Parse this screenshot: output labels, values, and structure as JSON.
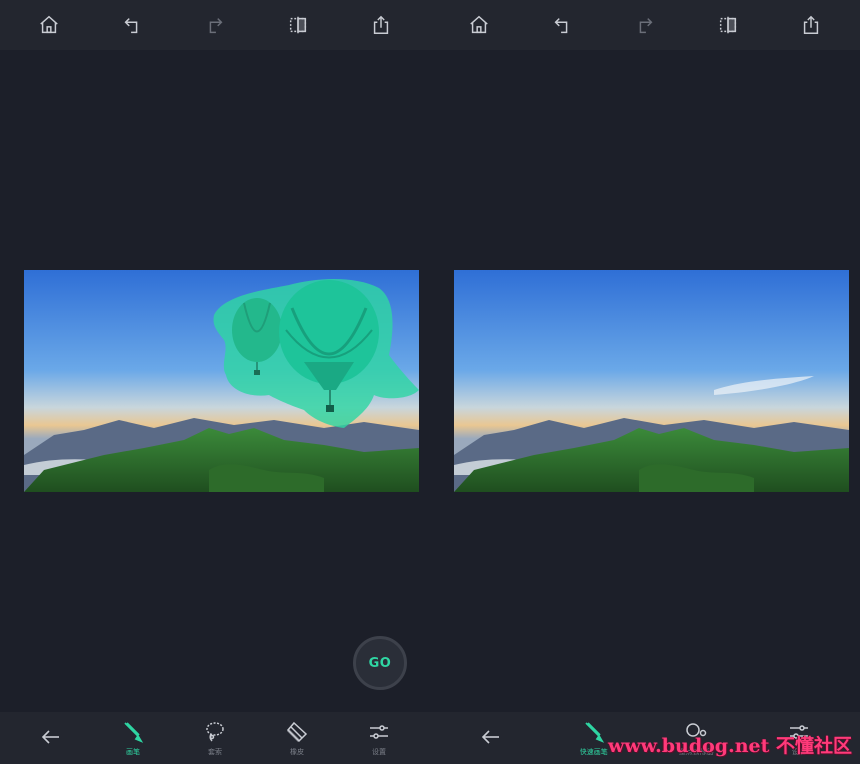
{
  "left_panel": {
    "topbar": {
      "icons": [
        "home-icon",
        "undo-icon",
        "redo-icon",
        "compare-icon",
        "share-icon"
      ]
    },
    "go_label": "GO",
    "tools": [
      {
        "icon": "arrow-left-icon",
        "label": ""
      },
      {
        "icon": "brush-icon",
        "label": "画笔",
        "active": true
      },
      {
        "icon": "lasso-icon",
        "label": "套索"
      },
      {
        "icon": "eraser-icon",
        "label": "橡皮"
      },
      {
        "icon": "settings-sliders-icon",
        "label": "设置"
      }
    ]
  },
  "right_panel": {
    "topbar": {
      "icons": [
        "home-icon",
        "undo-icon",
        "redo-icon",
        "compare-icon",
        "share-icon"
      ]
    },
    "tools": [
      {
        "icon": "arrow-left-icon",
        "label": ""
      },
      {
        "icon": "quick-brush-icon",
        "label": "快速画笔",
        "active": true
      },
      {
        "icon": "point-eraser-icon",
        "label": "重点去除器"
      },
      {
        "icon": "settings-icon",
        "label": "设置"
      }
    ]
  },
  "watermark": "www.budog.net 不懂社区",
  "colors": {
    "accent": "#2fd6a3",
    "background": "#1c1f29",
    "bar": "#23262f"
  }
}
